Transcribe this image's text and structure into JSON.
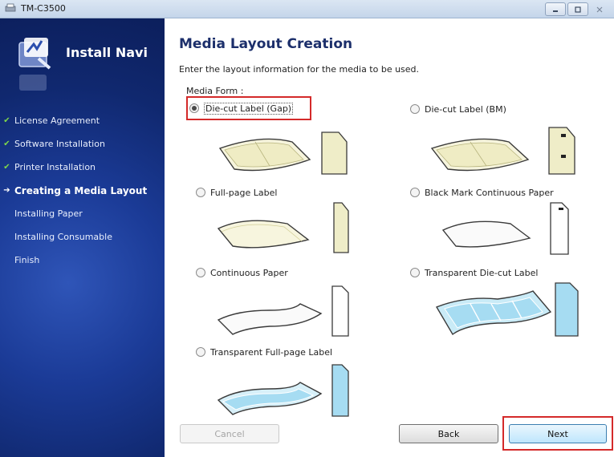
{
  "window": {
    "title": "TM-C3500",
    "controls": [
      "minimize-icon",
      "maximize-icon",
      "close-icon"
    ]
  },
  "sidebar": {
    "brand": "Install Navi",
    "steps": [
      {
        "label": "License Agreement",
        "state": "done",
        "marker": "✔"
      },
      {
        "label": "Software Installation",
        "state": "done",
        "marker": "✔"
      },
      {
        "label": "Printer Installation",
        "state": "done",
        "marker": "✔"
      },
      {
        "label": "Creating a Media Layout",
        "state": "current",
        "marker": "➔"
      },
      {
        "label": "Installing Paper",
        "state": "pending",
        "marker": ""
      },
      {
        "label": "Installing Consumable",
        "state": "pending",
        "marker": ""
      },
      {
        "label": "Finish",
        "state": "pending",
        "marker": ""
      }
    ]
  },
  "main": {
    "title": "Media Layout Creation",
    "description": "Enter the layout information for the media to be used.",
    "media_form_label": "Media Form :",
    "options": [
      {
        "label": "Die-cut Label (Gap)",
        "selected": true
      },
      {
        "label": "Die-cut Label (BM)",
        "selected": false
      },
      {
        "label": "Full-page Label",
        "selected": false
      },
      {
        "label": "Black Mark Continuous Paper",
        "selected": false
      },
      {
        "label": "Continuous Paper",
        "selected": false
      },
      {
        "label": "Transparent Die-cut Label",
        "selected": false
      },
      {
        "label": "Transparent Full-page Label",
        "selected": false
      }
    ]
  },
  "buttons": {
    "cancel": "Cancel",
    "back": "Back",
    "next": "Next"
  },
  "colors": {
    "sidebar_bg": "#1b3b97",
    "check_green": "#7fd84a",
    "title_blue": "#1c2f6b",
    "highlight_red": "#d42a2a",
    "label_cream": "#f2efc8",
    "transparent_blue": "#a6dcf2"
  }
}
